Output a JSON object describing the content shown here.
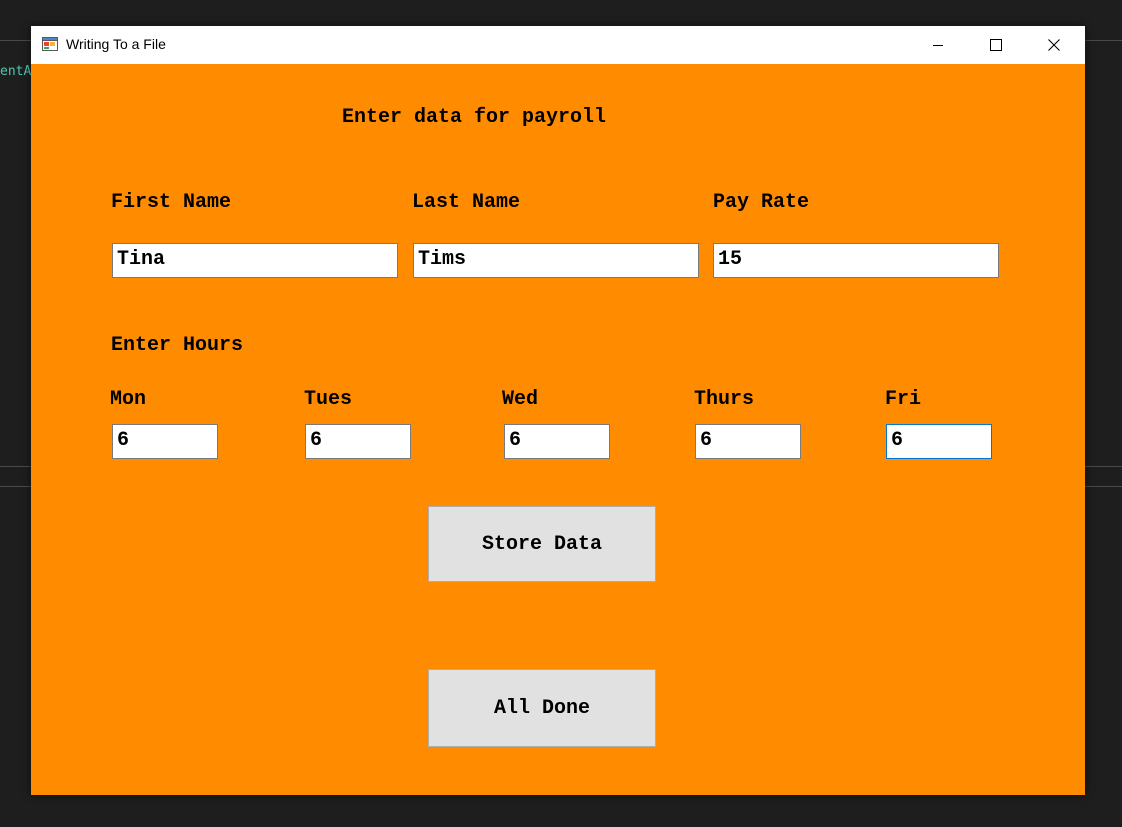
{
  "background": {
    "code_fragment": "entA",
    "accent_color": "#4ec9b0"
  },
  "window": {
    "title": "Writing To a File",
    "icon": "winforms-app-icon",
    "controls": {
      "minimize_icon": "minimize-icon",
      "maximize_icon": "maximize-icon",
      "close_icon": "close-icon"
    },
    "background_color": "#ff8c00"
  },
  "form": {
    "heading": "Enter data for payroll",
    "fields": {
      "first_name": {
        "label": "First Name",
        "value": "Tina"
      },
      "last_name": {
        "label": "Last Name",
        "value": "Tims"
      },
      "pay_rate": {
        "label": "Pay Rate",
        "value": "15"
      }
    },
    "hours": {
      "label": "Enter Hours",
      "days": [
        {
          "label": "Mon",
          "value": "6"
        },
        {
          "label": "Tues",
          "value": "6"
        },
        {
          "label": "Wed",
          "value": "6"
        },
        {
          "label": "Thurs",
          "value": "6"
        },
        {
          "label": "Fri",
          "value": "6"
        }
      ]
    },
    "buttons": {
      "store_label": "Store Data",
      "done_label": "All Done"
    }
  }
}
